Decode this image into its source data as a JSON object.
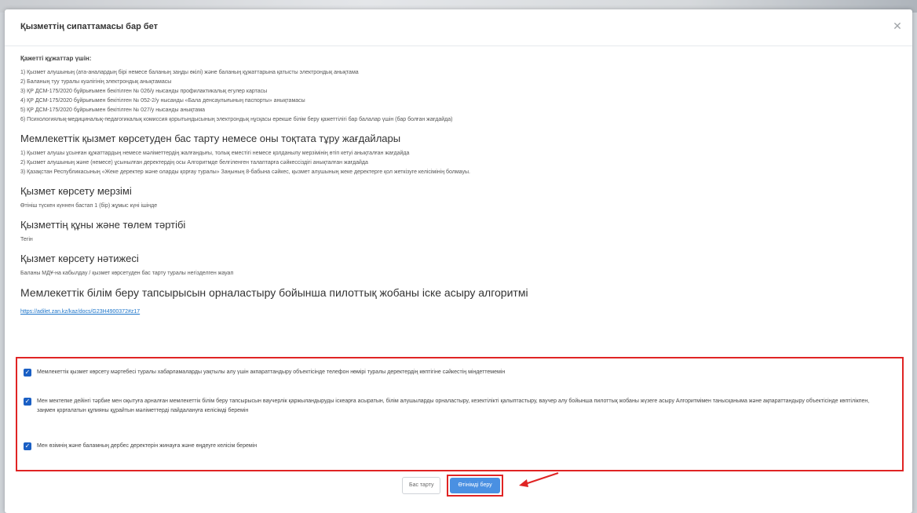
{
  "modal": {
    "title": "Қызметтің сипаттамасы бар бет",
    "close_icon": "close-icon"
  },
  "documents": {
    "heading": "Қажетті құжаттар үшін:",
    "lines": [
      "1) Қызмет алушының (ата-аналардың бірі немесе баланың заңды өкілі) және баланың құжаттарына қатысты электрондық анықтама",
      "2) Баланың туу туралы куәлігінің электрондық анықтамасы",
      "3) ҚР ДСМ-175/2020 бұйрығымен бекітілген № 026/у нысанды профилактикалық егулер картасы",
      "4) ҚР ДСМ-175/2020 бұйрығымен бекітілген № 052-2/у нысанды «Бала денсаулығының паспорты» анықтамасы",
      "5) ҚР ДСМ-175/2020 бұйрығымен бекітілген № 027/у нысанды анықтама",
      "6) Психологиялық-медициналық-педагогикалық комиссия қорытындысының электрондық нұсқасы ерекше білім беру қажеттілігі бар балалар үшін (бар болған жағдайда)"
    ]
  },
  "sections": [
    {
      "title": "Мемлекеттік қызмет көрсетуден бас тарту немесе оны тоқтата тұру жағдайлары",
      "lines": [
        "1) Қызмет алушы ұсынған құжаттардың немесе мәліметтердің жалғандығы, толық еместігі немесе қолданылу мерзімінің өтіп кетуі анықталған жағдайда",
        "2) Қызмет алушының және (немесе) ұсынылған деректердің осы Алгоритмде белгіленген талаптарға сәйкессіздігі анықталған жағдайда",
        "3) Қазақстан Республикасының «Жеке деректер және оларды қорғау туралы» Заңының 8-бабына сәйкес, қызмет алушының жеке деректерге қол жеткізуге келісімінің болмауы."
      ]
    },
    {
      "title": "Қызмет көрсету мерзімі",
      "lines": [
        "Өтініш түскен күннен бастап 1 (бір) жұмыс күні ішінде"
      ]
    },
    {
      "title": "Қызметтің құны және төлем тәртібі",
      "lines": [
        "Тегін"
      ]
    },
    {
      "title": "Қызмет көрсету нәтижесі",
      "lines": [
        "Баланы МДҰ-на кабылдау / қызмет көрсетуден бас тарту туралы негізделген жауап"
      ]
    }
  ],
  "algorithm": {
    "title": "Мемлекеттік білім беру тапсырысын орналастыру бойынша пилоттық жобаны іске асыру алгоритмі",
    "link": "https://adilet.zan.kz/kaz/docs/G23H4900372#z17"
  },
  "consents": [
    "Мемлекеттік қызмет көрсету мәртебесі туралы хабарламаларды уақтылы алу үшін акпараттандыру объектісінде телефон нөмірі туралы деректердің көптігіне сәйкестің міндеттемемін",
    "Мен мектепке дейінгі тәрбие мен оқытуға арналған мемлекеттік білім беру тапсырысын ваучерлік қаржыландыруды іскеарға асыратын, білім алушыларды орналастыру, кезектілікті қалыптастыру, ваучер алу бойынша пилоттық жобаны жүзеге асыру Алгоритмімен танысқаныма және ақпараттандыру объектісінде көптілікпен, заңмен қорғалатын құпияны құрайтын мәліметтерді пайдалануға келісімді беремін",
    "Мен өзімнің және баламның дербес деректерін жинауға және өңдеуге келісім беремін"
  ],
  "buttons": {
    "cancel": "Бас тарту",
    "next": "Өтінімді беру"
  },
  "colors": {
    "highlight": "#e02424",
    "primary": "#4a90e2",
    "checkbox": "#1a5fc4",
    "link": "#1a73c9"
  }
}
